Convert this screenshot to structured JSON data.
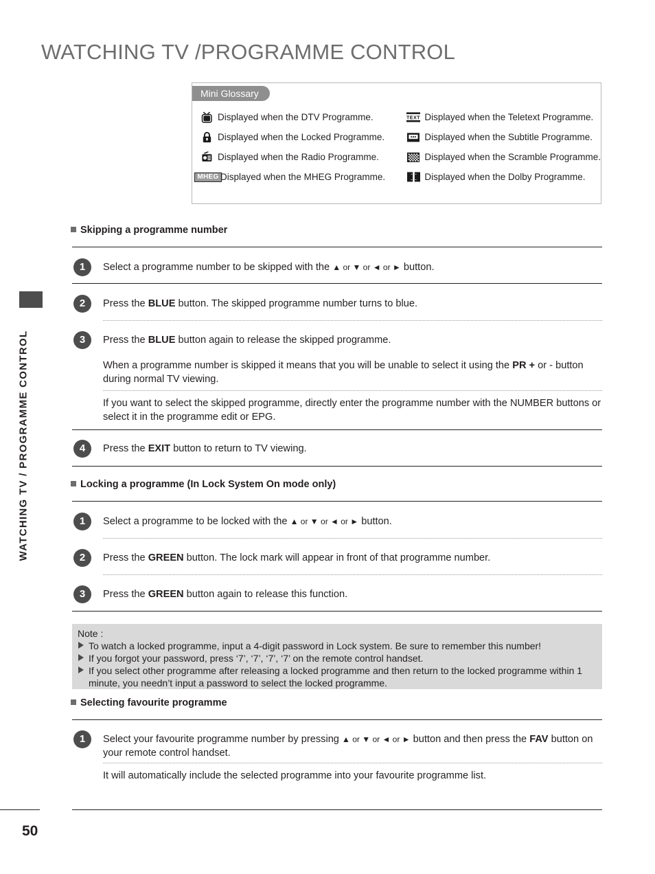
{
  "page": {
    "title": "WATCHING TV /PROGRAMME CONTROL",
    "side_tab_label": "WATCHING TV / PROGRAMME CONTROL",
    "page_number": "50"
  },
  "glossary": {
    "tab_label": "Mini Glossary",
    "left_items": [
      {
        "icon": "tv-icon",
        "text": "Displayed when the DTV Programme."
      },
      {
        "icon": "lock-icon",
        "text": "Displayed when the Locked Programme."
      },
      {
        "icon": "radio-icon",
        "text": "Displayed when the Radio Programme."
      },
      {
        "icon": "mheg-icon",
        "icon_label": "MHEG",
        "text": "Displayed when the MHEG Programme."
      }
    ],
    "right_items": [
      {
        "icon": "teletext-icon",
        "icon_label": "TEXT",
        "text": "Displayed when the Teletext Programme."
      },
      {
        "icon": "subtitle-icon",
        "text": "Displayed when the Subtitle Programme."
      },
      {
        "icon": "scramble-icon",
        "text": "Displayed when the Scramble Programme."
      },
      {
        "icon": "dolby-icon",
        "text": "Displayed when the Dolby Programme."
      }
    ]
  },
  "sections": {
    "skipping": {
      "heading": "Skipping a programme number",
      "step1_num": "1",
      "step1_a": "Select a programme number to be skipped with the ",
      "step1_up": "▲",
      "step1_or1": " or ",
      "step1_down": "▼",
      "step1_or2": " or ",
      "step1_left": "◄",
      "step1_or3": " or ",
      "step1_right": "►",
      "step1_b": " button.",
      "step2_num": "2",
      "step2_a": "Press the ",
      "step2_bold": "BLUE",
      "step2_b": " button. The skipped programme number turns to blue.",
      "step3_num": "3",
      "step3_a": "Press the ",
      "step3_bold": "BLUE",
      "step3_b": " button again to release the skipped programme.",
      "para1_a": "When a programme number is skipped it means that you will be unable to select it using the ",
      "para1_bold": "PR +",
      "para1_b": " or - button during normal TV viewing.",
      "para2": "If you want to select the skipped programme, directly enter the programme number with the NUMBER buttons or select it in the programme edit or EPG.",
      "step4_num": "4",
      "step4_a": "Press the ",
      "step4_bold": "EXIT",
      "step4_b": " button to return to TV viewing."
    },
    "locking": {
      "heading": "Locking a programme (In Lock System On mode only)",
      "step1_num": "1",
      "step1_a": "Select a programme to be locked with the ",
      "step1_up": "▲",
      "step1_or1": " or ",
      "step1_down": "▼",
      "step1_or2": " or ",
      "step1_left": "◄",
      "step1_or3": " or ",
      "step1_right": "►",
      "step1_b": " button.",
      "step2_num": "2",
      "step2_a": "Press the ",
      "step2_bold": "GREEN",
      "step2_b": " button. The lock mark will appear in front of that programme number.",
      "step3_num": "3",
      "step3_a": "Press the ",
      "step3_bold": "GREEN",
      "step3_b": " button again to release this function."
    },
    "note": {
      "title": "Note :",
      "items": [
        "To watch a locked programme, input a 4-digit password in Lock system. Be sure to remember this number!",
        "If you forgot your password, press ‘7’, ‘7’, ‘7’, ‘7’ on the remote control handset.",
        "If you select other programme after releasing a locked programme and then return to the locked programme within 1 minute, you needn’t input a password to select the locked programme."
      ]
    },
    "favourite": {
      "heading": "Selecting favourite programme",
      "step1_num": "1",
      "step1_a": "Select your favourite programme number by pressing ",
      "step1_up": "▲",
      "step1_or1": " or ",
      "step1_down": "▼",
      "step1_or2": " or ",
      "step1_left": "◄",
      "step1_or3": " or ",
      "step1_right": "►",
      "step1_b": " button and then press the ",
      "step1_bold": "FAV",
      "step1_c": " button on your remote control handset.",
      "para1": "It will automatically include the selected programme into your favourite programme list."
    }
  },
  "colors": {
    "title_gray": "#6d6d6d",
    "circle_gray": "#4d4d4d",
    "note_bg": "#d9d9d9",
    "tab_gray": "#8f8f8f"
  }
}
